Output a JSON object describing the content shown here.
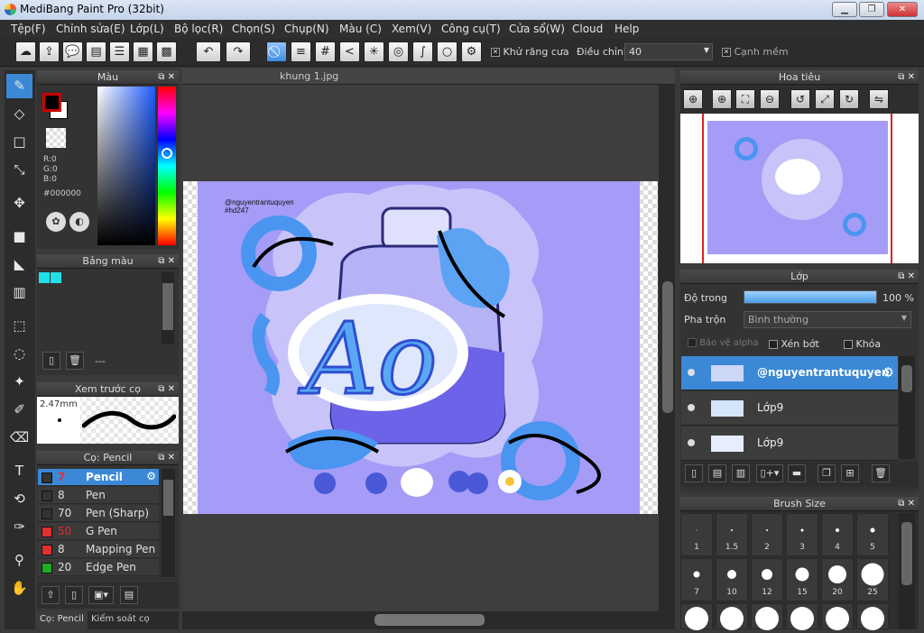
{
  "window": {
    "title": "MediBang Paint Pro (32bit)"
  },
  "menu": [
    "Tệp(F)",
    "Chỉnh sửa(E)",
    "Lớp(L)",
    "Bộ lọc(R)",
    "Chọn(S)",
    "Chụp(N)",
    "Màu (C)",
    "Xem(V)",
    "Công cụ(T)",
    "Cửa sổ(W)",
    "Cloud",
    "Help"
  ],
  "toolbar": {
    "antialias_label": "Khử răng cưa",
    "adjust_label": "Điều chỉnh",
    "adjust_value": "40",
    "soft_edge_label": "Cạnh mềm"
  },
  "color_panel": {
    "title": "Màu",
    "r": "R:0",
    "g": "G:0",
    "b": "B:0",
    "hex": "#000000",
    "fg": "#cc0000",
    "bg": "#ffffff"
  },
  "palette_panel": {
    "title": "Bảng màu",
    "swatches": [
      "#22e0e8",
      "#22e0e8"
    ],
    "page": "---"
  },
  "brush_preview": {
    "title": "Xem trước cọ",
    "size": "2.47mm"
  },
  "brush_panel": {
    "title": "Cọ: Pencil",
    "items": [
      {
        "size": "7",
        "name": "Pencil",
        "color": "#333333"
      },
      {
        "size": "8",
        "name": "Pen",
        "color": "#333333"
      },
      {
        "size": "70",
        "name": "Pen (Sharp)",
        "color": "#333333"
      },
      {
        "size": "50",
        "name": "G Pen",
        "color": "#e03030"
      },
      {
        "size": "8",
        "name": "Mapping Pen",
        "color": "#e03030"
      },
      {
        "size": "20",
        "name": "Edge Pen",
        "color": "#22aa22"
      }
    ],
    "tab_brush": "Cọ: Pencil",
    "tab_control": "Kiểm soát cọ"
  },
  "canvas": {
    "tab": "khung 1.jpg",
    "artwork": {
      "handle": "@nguyentrantuquyen",
      "tag": "#hd247",
      "letters": "Ao"
    }
  },
  "navigator": {
    "title": "Hoa tiêu"
  },
  "layer_panel": {
    "title": "Lớp",
    "opacity_label": "Độ trong",
    "opacity_value": "100 %",
    "opacity": 1.0,
    "blend_label": "Pha trộn",
    "blend_value": "Bình thường",
    "protect_alpha": "Bảo vệ alpha",
    "clip": "Xén bớt",
    "lock": "Khóa",
    "layers": [
      {
        "name": "@nguyentrantuquyen"
      },
      {
        "name": "Lớp9"
      },
      {
        "name": "Lớp9"
      }
    ]
  },
  "brush_size": {
    "title": "Brush Size",
    "sizes": [
      "1",
      "1.5",
      "2",
      "3",
      "4",
      "5",
      "7",
      "10",
      "12",
      "15",
      "20",
      "25"
    ]
  }
}
